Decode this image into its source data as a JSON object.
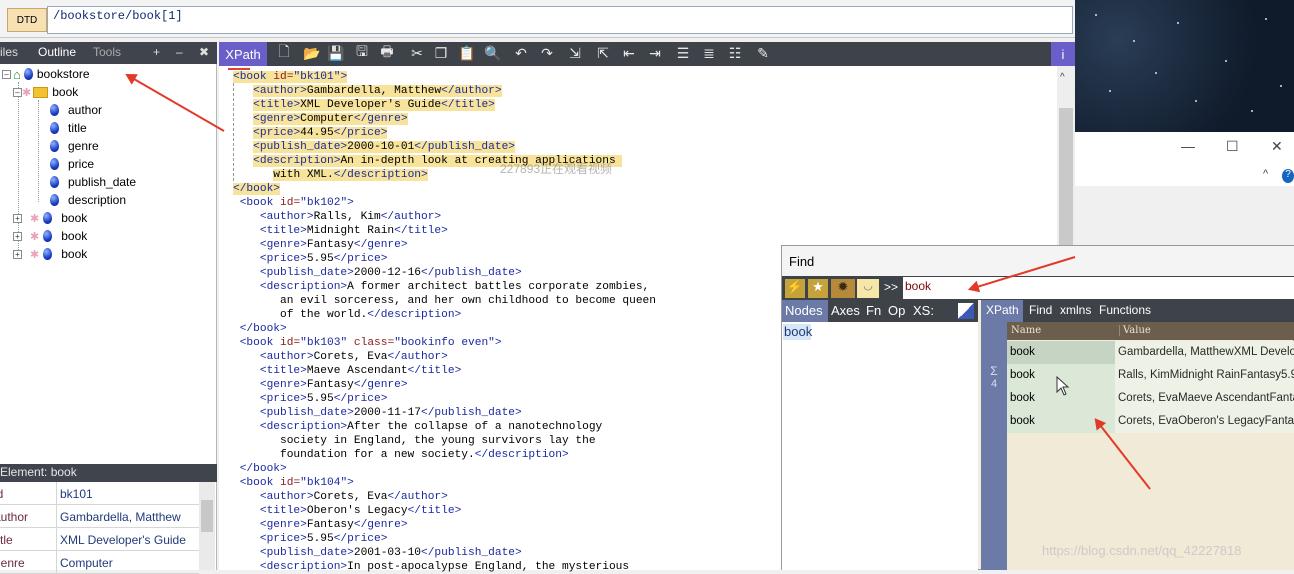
{
  "address": {
    "dtd_label": "DTD",
    "xpath": "/bookstore/book[1]"
  },
  "left_tabs": {
    "files": "iles",
    "outline": "Outline",
    "tools": "Tools",
    "plus": "+",
    "minus": "–",
    "close": "✖"
  },
  "tree": {
    "root": "bookstore",
    "book": "book",
    "children": [
      "author",
      "title",
      "genre",
      "price",
      "publish_date",
      "description"
    ],
    "collapsed": [
      "book",
      "book",
      "book"
    ]
  },
  "element_panel": {
    "header": "Element: book",
    "rows": [
      {
        "key": "id",
        "value": "bk101"
      },
      {
        "key": "author",
        "value": "Gambardella, Matthew"
      },
      {
        "key": "title",
        "value": "XML Developer's Guide"
      },
      {
        "key": "genre",
        "value": "Computer"
      }
    ]
  },
  "toolbar": {
    "xpath_tab": "XPath",
    "info": "i"
  },
  "watermark_code": "227...",
  "find": {
    "title": "Find",
    "query": "book",
    "left_tabs": [
      "Nodes",
      "Axes",
      "Fn",
      "Op",
      "XS:"
    ],
    "node_result": "book",
    "right_tabs": [
      "XPath",
      "Find",
      "xmlns",
      "Functions"
    ],
    "count_symbol": "Σ",
    "count": "4",
    "columns": {
      "name": "Name",
      "value": "Value"
    },
    "rows": [
      {
        "name": "book",
        "value": "Gambardella, MatthewXML Develope"
      },
      {
        "name": "book",
        "value": "Ralls, KimMidnight RainFantasy5.952"
      },
      {
        "name": "book",
        "value": "Corets, EvaMaeve AscendantFantas"
      },
      {
        "name": "book",
        "value": "Corets, EvaOberon's LegacyFantasy5"
      }
    ]
  },
  "watermark": "https://blog.csdn.net/qq_42227818",
  "overlay_text": "227893正在观看视频"
}
